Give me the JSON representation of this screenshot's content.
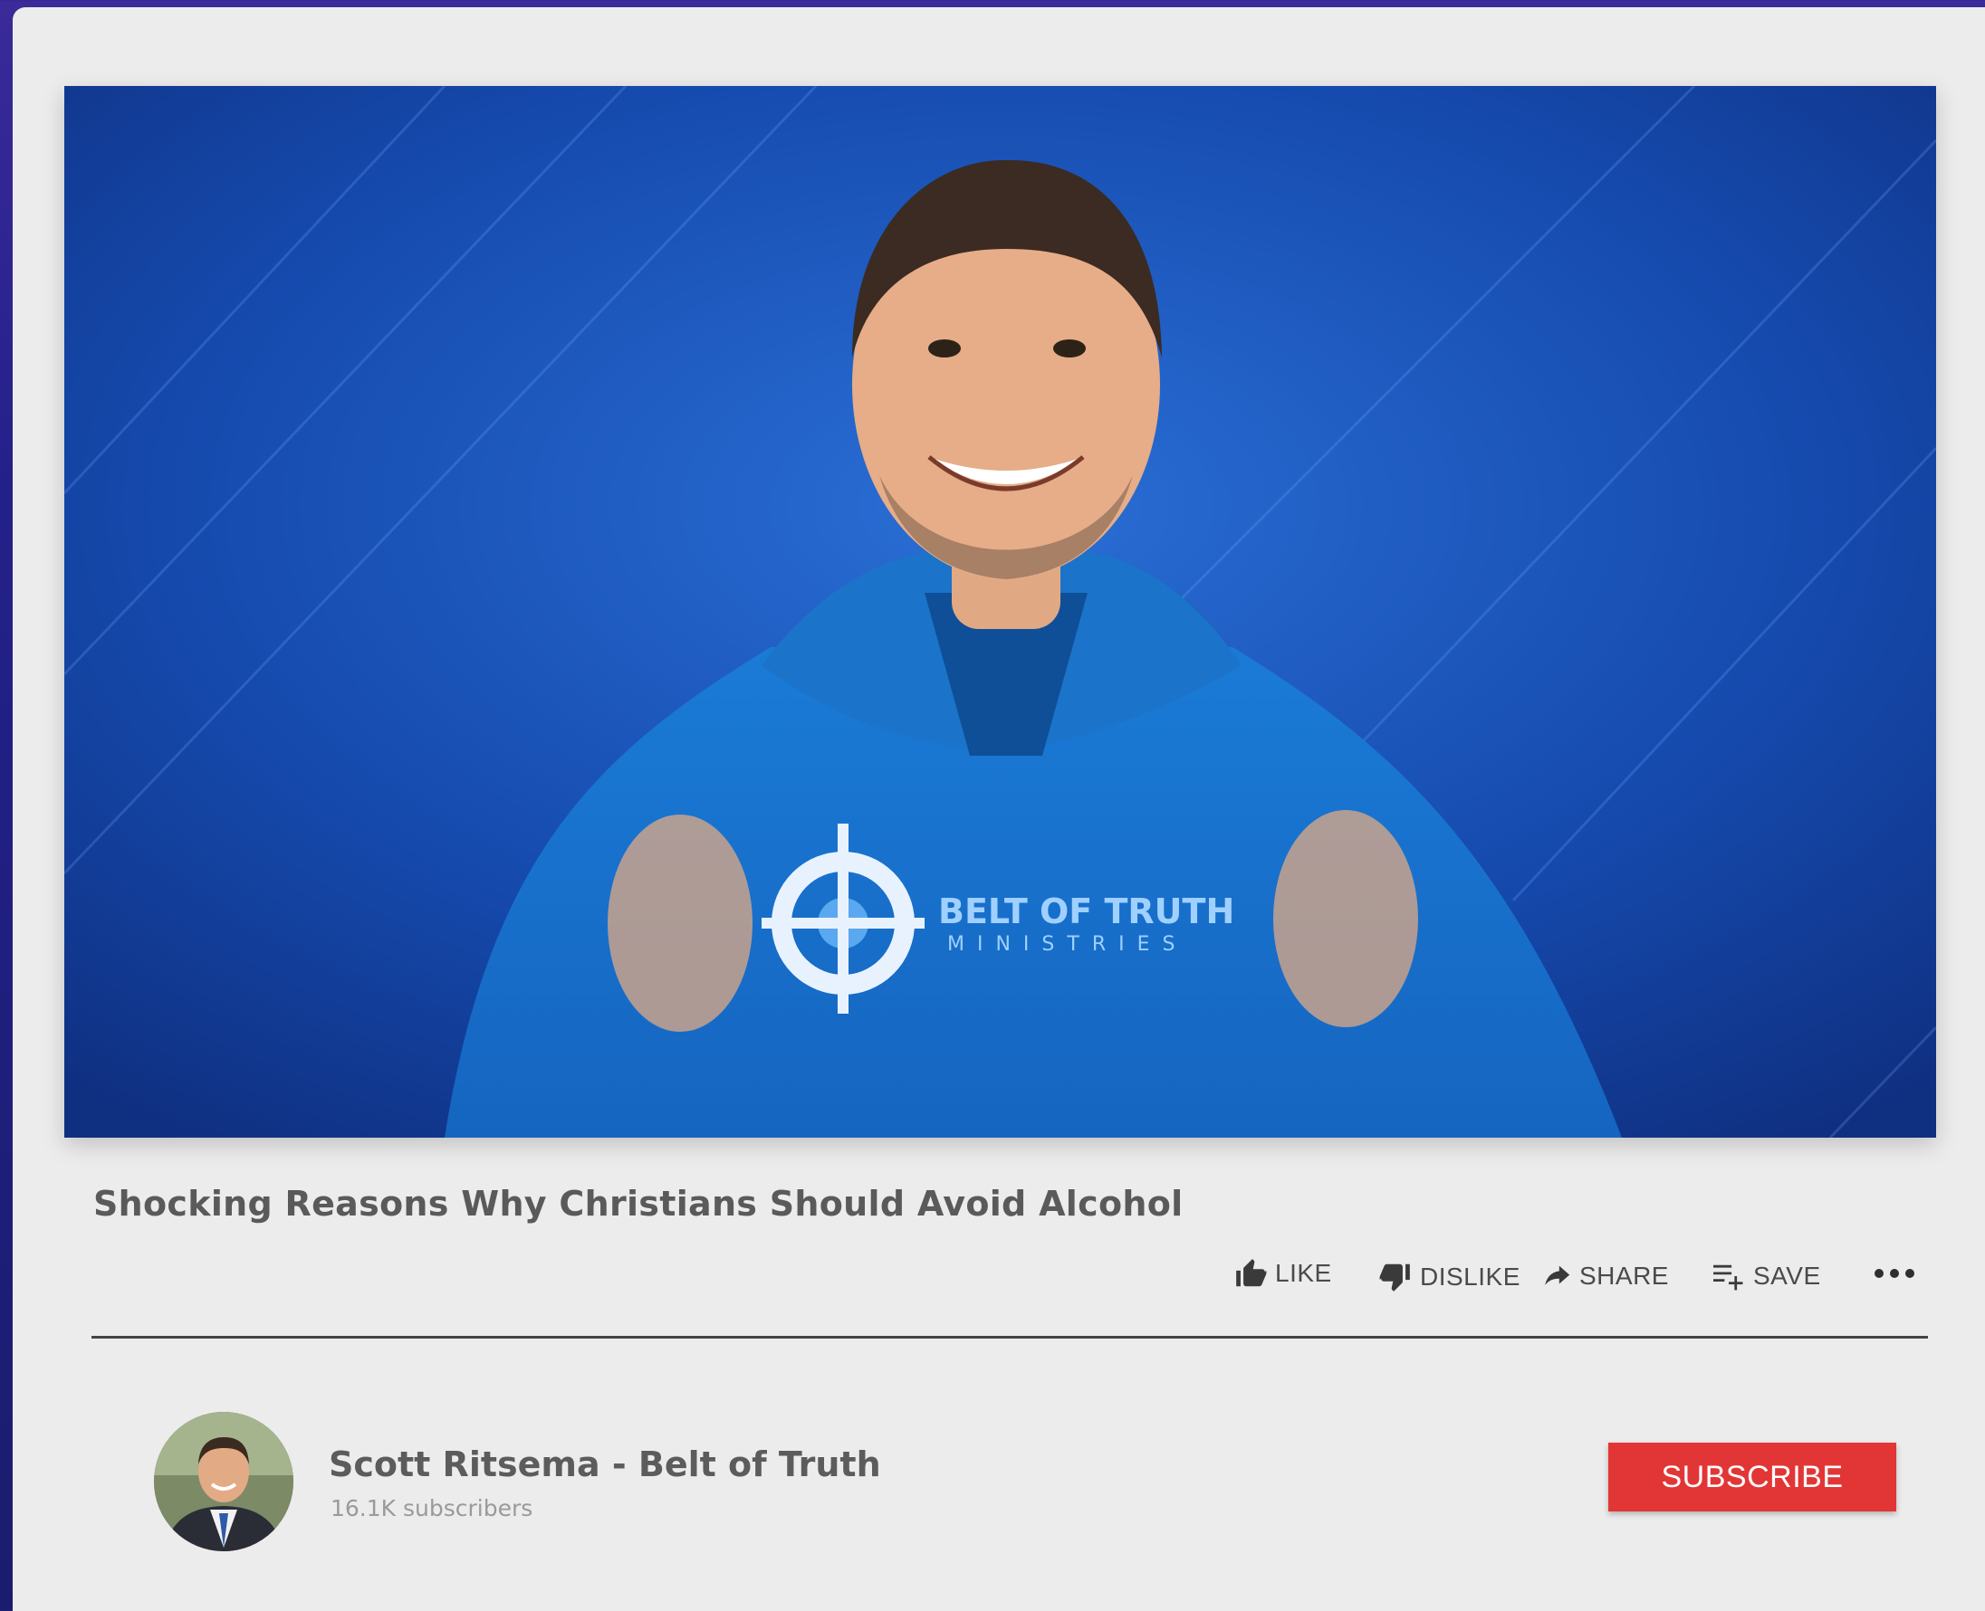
{
  "video": {
    "title": "Shocking Reasons Why Christians Should Avoid Alcohol",
    "hoodie_logo_line1": "BELT OF TRUTH",
    "hoodie_logo_line2": "MINISTRIES"
  },
  "actions": {
    "like_label": "LIKE",
    "dislike_label": "DISLIKE",
    "share_label": "SHARE",
    "save_label": "SAVE",
    "more_icon": "more-horizontal-icon"
  },
  "channel": {
    "name": "Scott Ritsema - Belt of Truth",
    "subscribers": "16.1K subscribers",
    "subscribe_label": "SUBSCRIBE"
  },
  "colors": {
    "accent": "#e23636",
    "video_background": "#1546a8",
    "card_background": "#ececec",
    "page_background": "#24208a"
  }
}
